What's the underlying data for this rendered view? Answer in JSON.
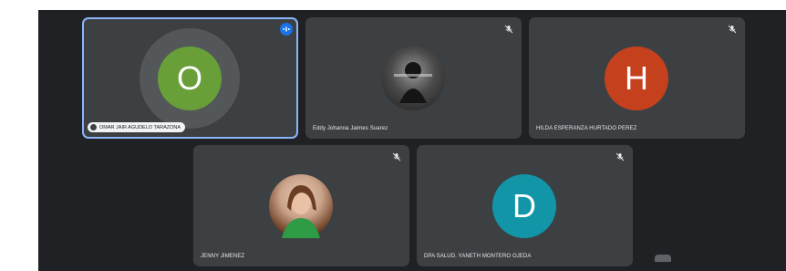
{
  "participants": [
    {
      "name": "OMAR JAIR AGUDELO TARAZONA",
      "initial": "O",
      "avatar_color": "#689f38",
      "state": "speaking",
      "icon": "speaking-icon"
    },
    {
      "name": "Eddy Johanna Jaimes Suarez",
      "initial": "",
      "avatar_color": "#2b2b2b",
      "state": "muted",
      "icon": "mic-off-icon"
    },
    {
      "name": "HILDA ESPERANZA HURTADO PEREZ",
      "initial": "H",
      "avatar_color": "#c5411e",
      "state": "muted",
      "icon": "mic-off-icon"
    },
    {
      "name": "JENNY JIMENEZ",
      "initial": "",
      "avatar_color": "#caa38a",
      "state": "muted",
      "icon": "mic-off-icon"
    },
    {
      "name": "DPA SALUD. YANETH MONTERO OJEDA",
      "initial": "D",
      "avatar_color": "#1295a7",
      "state": "muted",
      "icon": "mic-off-icon"
    }
  ],
  "colors": {
    "background": "#202124",
    "tile": "#3c4043",
    "active_border": "#8ab4f8",
    "speaking_badge": "#1a73e8"
  }
}
